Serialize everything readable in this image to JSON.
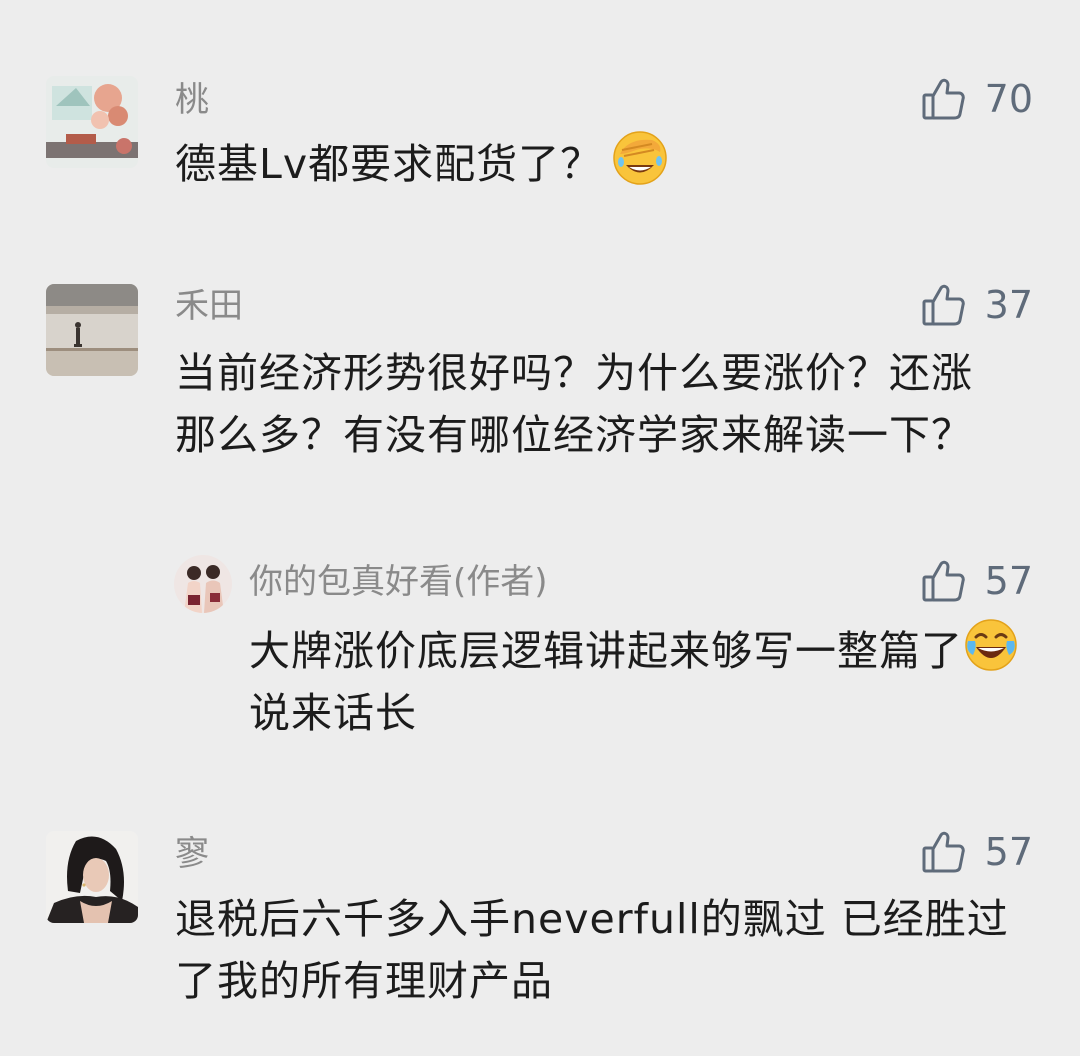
{
  "comments": [
    {
      "name": "桃",
      "likes": "70",
      "text": "德基Lv都要求配货了？",
      "emoji": "face-palm-laughing-emoji",
      "avatar": "flower-collage-avatar"
    },
    {
      "name": "禾田",
      "likes": "37",
      "text": "当前经济形势很好吗？为什么要涨价？还涨那么多？有没有哪位经济学家来解读一下？",
      "avatar": "person-on-beach-avatar",
      "reply": {
        "name": "你的包真好看(作者)",
        "likes": "57",
        "text_before": "大牌涨价底层逻辑讲起来够写一整篇了",
        "emoji": "tears-of-joy-emoji",
        "text_after": "说来话长",
        "avatar": "two-women-avatar"
      }
    },
    {
      "name": "寥",
      "likes": "57",
      "text": "退税后六千多入手neverfull的飘过 已经胜过了我的所有理财产品",
      "avatar": "woman-portrait-avatar"
    }
  ],
  "icons": {
    "like": "thumbs-up-icon"
  },
  "colors": {
    "background": "#ededed",
    "name": "#8a8a8a",
    "text": "#1c1c1c",
    "like": "#5f6b7a"
  }
}
